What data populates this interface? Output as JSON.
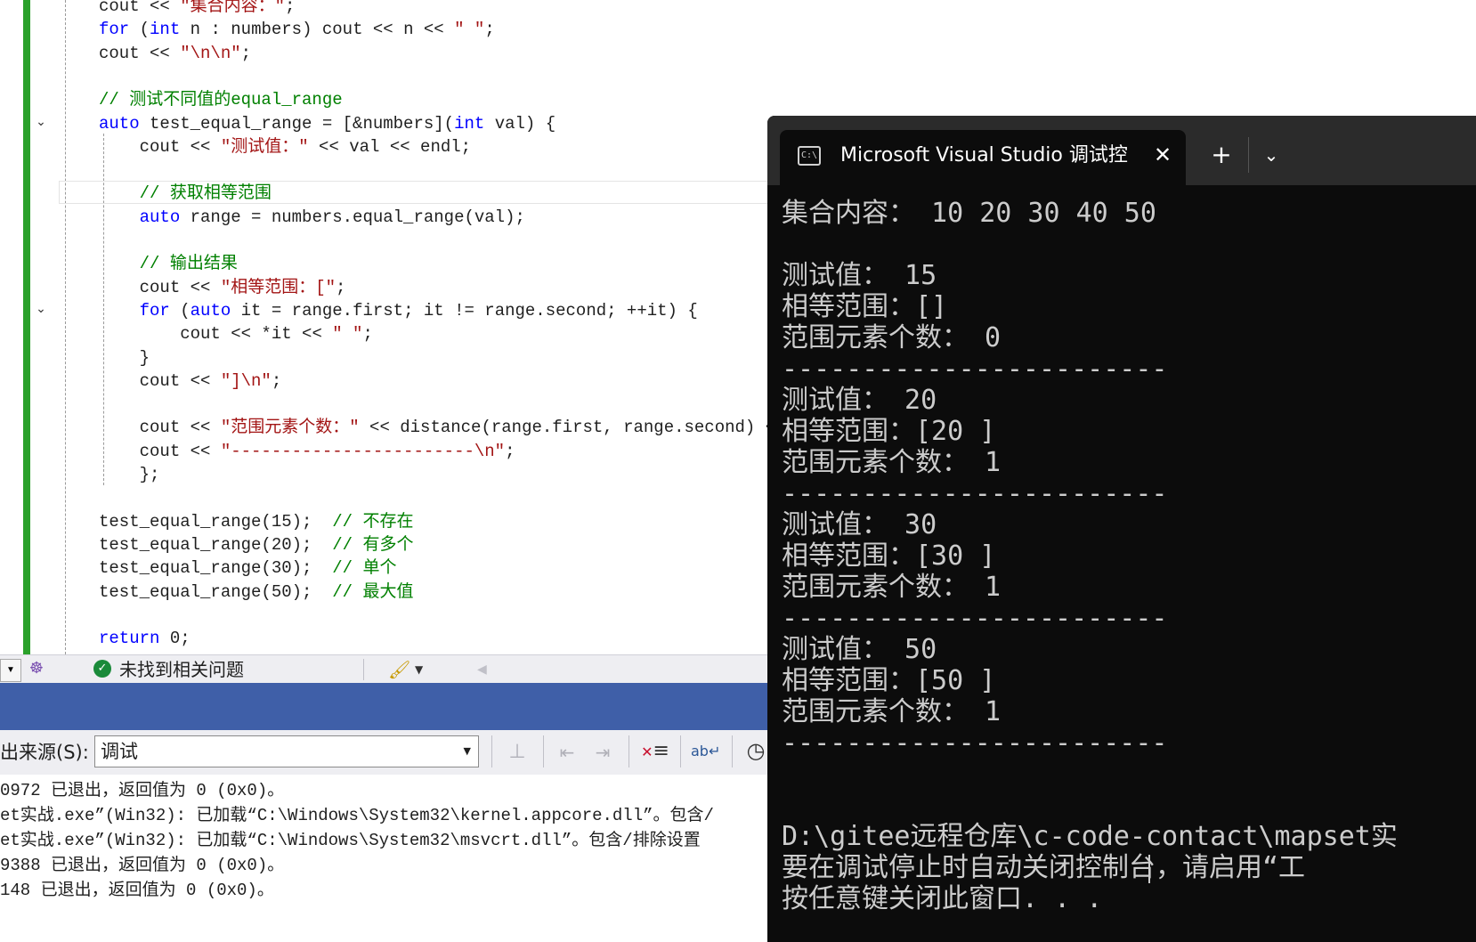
{
  "editor": {
    "lines": [
      {
        "t": [
          [
            "cout",
            ""
          ],
          [
            " << ",
            ""
          ],
          [
            "\"集合内容：\"",
            "st"
          ],
          [
            ";",
            ""
          ]
        ]
      },
      {
        "t": [
          [
            "for",
            "kw"
          ],
          [
            " (",
            ""
          ],
          [
            "int",
            "kw"
          ],
          [
            " n : numbers) cout << n << ",
            ""
          ],
          [
            "\" \"",
            "st"
          ],
          [
            ";",
            ""
          ]
        ]
      },
      {
        "t": [
          [
            "cout << ",
            ""
          ],
          [
            "\"\\n\\n\"",
            "st"
          ],
          [
            ";",
            ""
          ]
        ]
      },
      {
        "t": []
      },
      {
        "t": [
          [
            "// 测试不同值的equal_range",
            "cm"
          ]
        ]
      },
      {
        "t": [
          [
            "auto",
            "kw"
          ],
          [
            " test_equal_range = [&numbers](",
            ""
          ],
          [
            "int",
            "kw"
          ],
          [
            " val) {",
            ""
          ]
        ]
      },
      {
        "t": [
          [
            "    cout << ",
            ""
          ],
          [
            "\"测试值：\"",
            "st"
          ],
          [
            " << val << endl;",
            ""
          ]
        ]
      },
      {
        "t": []
      },
      {
        "t": [
          [
            "    // 获取相等范围",
            "cm"
          ]
        ]
      },
      {
        "t": [
          [
            "    ",
            ""
          ],
          [
            "auto",
            "kw"
          ],
          [
            " range = numbers.equal_range(val);",
            ""
          ]
        ]
      },
      {
        "t": []
      },
      {
        "t": [
          [
            "    // 输出结果",
            "cm"
          ]
        ]
      },
      {
        "t": [
          [
            "    cout << ",
            ""
          ],
          [
            "\"相等范围：[\"",
            "st"
          ],
          [
            ";",
            ""
          ]
        ]
      },
      {
        "t": [
          [
            "    ",
            ""
          ],
          [
            "for",
            "kw"
          ],
          [
            " (",
            ""
          ],
          [
            "auto",
            "kw"
          ],
          [
            " it = range.first; it != range.second; ++it) {",
            ""
          ]
        ]
      },
      {
        "t": [
          [
            "        cout << *it << ",
            ""
          ],
          [
            "\" \"",
            "st"
          ],
          [
            ";",
            ""
          ]
        ]
      },
      {
        "t": [
          [
            "    }",
            ""
          ]
        ]
      },
      {
        "t": [
          [
            "    cout << ",
            ""
          ],
          [
            "\"]\\n\"",
            "st"
          ],
          [
            ";",
            ""
          ]
        ]
      },
      {
        "t": []
      },
      {
        "t": [
          [
            "    cout << ",
            ""
          ],
          [
            "\"范围元素个数：\"",
            "st"
          ],
          [
            " << distance(range.first, range.second) <<",
            ""
          ]
        ]
      },
      {
        "t": [
          [
            "    cout << ",
            ""
          ],
          [
            "\"------------------------\\n\"",
            "st"
          ],
          [
            ";",
            ""
          ]
        ]
      },
      {
        "t": [
          [
            "    };",
            ""
          ]
        ]
      },
      {
        "t": []
      },
      {
        "t": [
          [
            "test_equal_range(15);  ",
            ""
          ],
          [
            "// 不存在",
            "cm"
          ]
        ]
      },
      {
        "t": [
          [
            "test_equal_range(20);  ",
            ""
          ],
          [
            "// 有多个",
            "cm"
          ]
        ]
      },
      {
        "t": [
          [
            "test_equal_range(30);  ",
            ""
          ],
          [
            "// 单个",
            "cm"
          ]
        ]
      },
      {
        "t": [
          [
            "test_equal_range(50);  ",
            ""
          ],
          [
            "// 最大值",
            "cm"
          ]
        ]
      },
      {
        "t": []
      },
      {
        "t": [
          [
            "return",
            "kw"
          ],
          [
            " 0;",
            ""
          ]
        ]
      }
    ]
  },
  "status": {
    "issues_text": "未找到相关问题"
  },
  "output": {
    "source_label": "出来源(S):",
    "source_value": "调试",
    "lines": [
      "0972 已退出，返回值为 0 (0x0)。",
      "et实战.exe”(Win32): 已加载“C:\\Windows\\System32\\kernel.appcore.dll”。包含/",
      "et实战.exe”(Win32): 已加载“C:\\Windows\\System32\\msvcrt.dll”。包含/排除设置",
      "9388 已退出，返回值为 0 (0x0)。",
      "148 已退出，返回值为 0 (0x0)。"
    ]
  },
  "terminal": {
    "tab_title": "Microsoft Visual Studio 调试控",
    "lines": [
      "集合内容： 10 20 30 40 50",
      "",
      "测试值： 15",
      "相等范围：[]",
      "范围元素个数： 0",
      "------------------------",
      "测试值： 20",
      "相等范围：[20 ]",
      "范围元素个数： 1",
      "------------------------",
      "测试值： 30",
      "相等范围：[30 ]",
      "范围元素个数： 1",
      "------------------------",
      "测试值： 50",
      "相等范围：[50 ]",
      "范围元素个数： 1",
      "------------------------",
      "",
      "",
      "D:\\gitee远程仓库\\c-code-contact\\mapset实",
      "要在调试停止时自动关闭控制台，请启用“工",
      "按任意键关闭此窗口. . ."
    ]
  },
  "colors": {
    "green_gutter": "#2aa12a",
    "blue_bar": "#3f5fa8",
    "terminal_bg": "#0c0c0c",
    "terminal_text": "#cccccc"
  }
}
